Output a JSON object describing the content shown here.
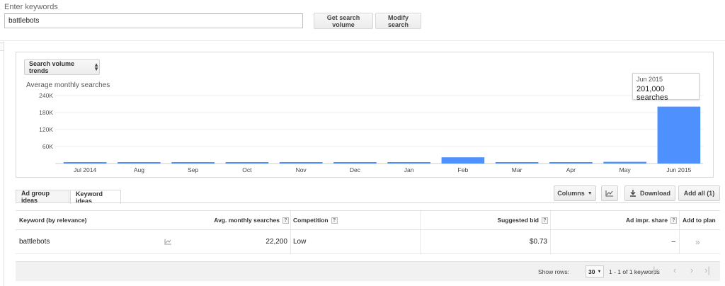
{
  "search": {
    "label": "Enter keywords",
    "value": "battlebots",
    "get_volume_label": "Get search volume",
    "modify_label": "Modify search"
  },
  "chart_panel": {
    "selector_label": "Search volume trends",
    "title": "Average monthly searches",
    "tooltip": {
      "date": "Jun 2015",
      "value": "201,000 searches"
    }
  },
  "chart_data": {
    "type": "bar",
    "title": "Average monthly searches",
    "categories": [
      "Jul 2014",
      "Aug",
      "Sep",
      "Oct",
      "Nov",
      "Dec",
      "Jan",
      "Feb",
      "Mar",
      "Apr",
      "May",
      "Jun 2015"
    ],
    "values": [
      3000,
      2500,
      2000,
      2000,
      3000,
      3000,
      3000,
      22000,
      4500,
      4000,
      6000,
      201000
    ],
    "yticks": [
      "60K",
      "120K",
      "180K",
      "240K"
    ],
    "ylim": [
      0,
      240000
    ],
    "grid": true,
    "color": "#4d90fe"
  },
  "tabs": {
    "ad_group": "Ad group ideas",
    "keyword": "Keyword ideas"
  },
  "toolbar": {
    "columns": "Columns",
    "download": "Download",
    "add_all": "Add all (1)"
  },
  "table": {
    "headers": {
      "keyword": "Keyword (by relevance)",
      "avg": "Avg. monthly searches",
      "competition": "Competition",
      "bid": "Suggested bid",
      "impr": "Ad impr. share",
      "add": "Add to plan"
    },
    "rows": [
      {
        "keyword": "battlebots",
        "avg": "22,200",
        "competition": "Low",
        "bid": "$0.73",
        "impr": "–",
        "add": "»"
      }
    ]
  },
  "footer": {
    "show_rows": "Show rows:",
    "rows_value": "30",
    "range": "1 - 1 of 1 keywords"
  }
}
